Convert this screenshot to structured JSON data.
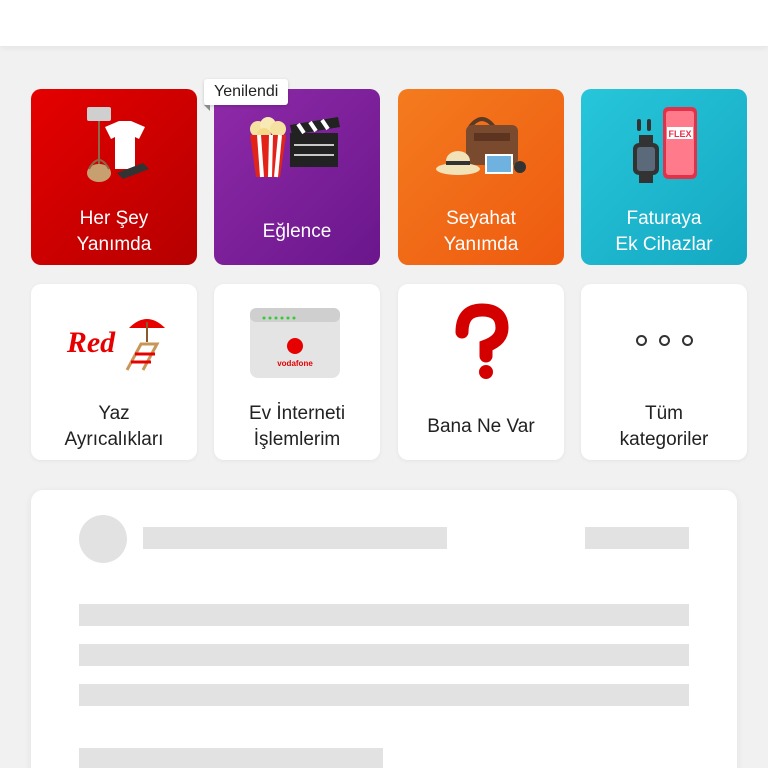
{
  "badge": {
    "label": "Yenilendi"
  },
  "tiles": [
    {
      "label": "Her Şey\nYanımda",
      "color": "#d00000",
      "icon": "clothing-bag-icon"
    },
    {
      "label": "Eğlence",
      "color": "#7b1f9a",
      "icon": "popcorn-clapper-icon"
    },
    {
      "label": "Seyahat\nYanımda",
      "color": "#f26a12",
      "icon": "travel-bag-icon"
    },
    {
      "label": "Faturaya\nEk Cihazlar",
      "color": "#1fb8cf",
      "icon": "phone-watch-icon"
    },
    {
      "label": "Yaz\nAyrıcalıkları",
      "icon": "red-beach-chair-icon"
    },
    {
      "label": "Ev İnterneti\nİşlemlerim",
      "icon": "modem-icon"
    },
    {
      "label": "Bana Ne Var",
      "icon": "question-mark-icon"
    },
    {
      "label": "Tüm\nkategoriler",
      "icon": "more-dots-icon"
    }
  ],
  "art_text": {
    "red": "Red",
    "vodafone": "vodafone",
    "flex": "FLEX"
  },
  "colors": {
    "accent": "#e60000",
    "background": "#f1f1f1",
    "skeleton": "#e2e2e2"
  }
}
